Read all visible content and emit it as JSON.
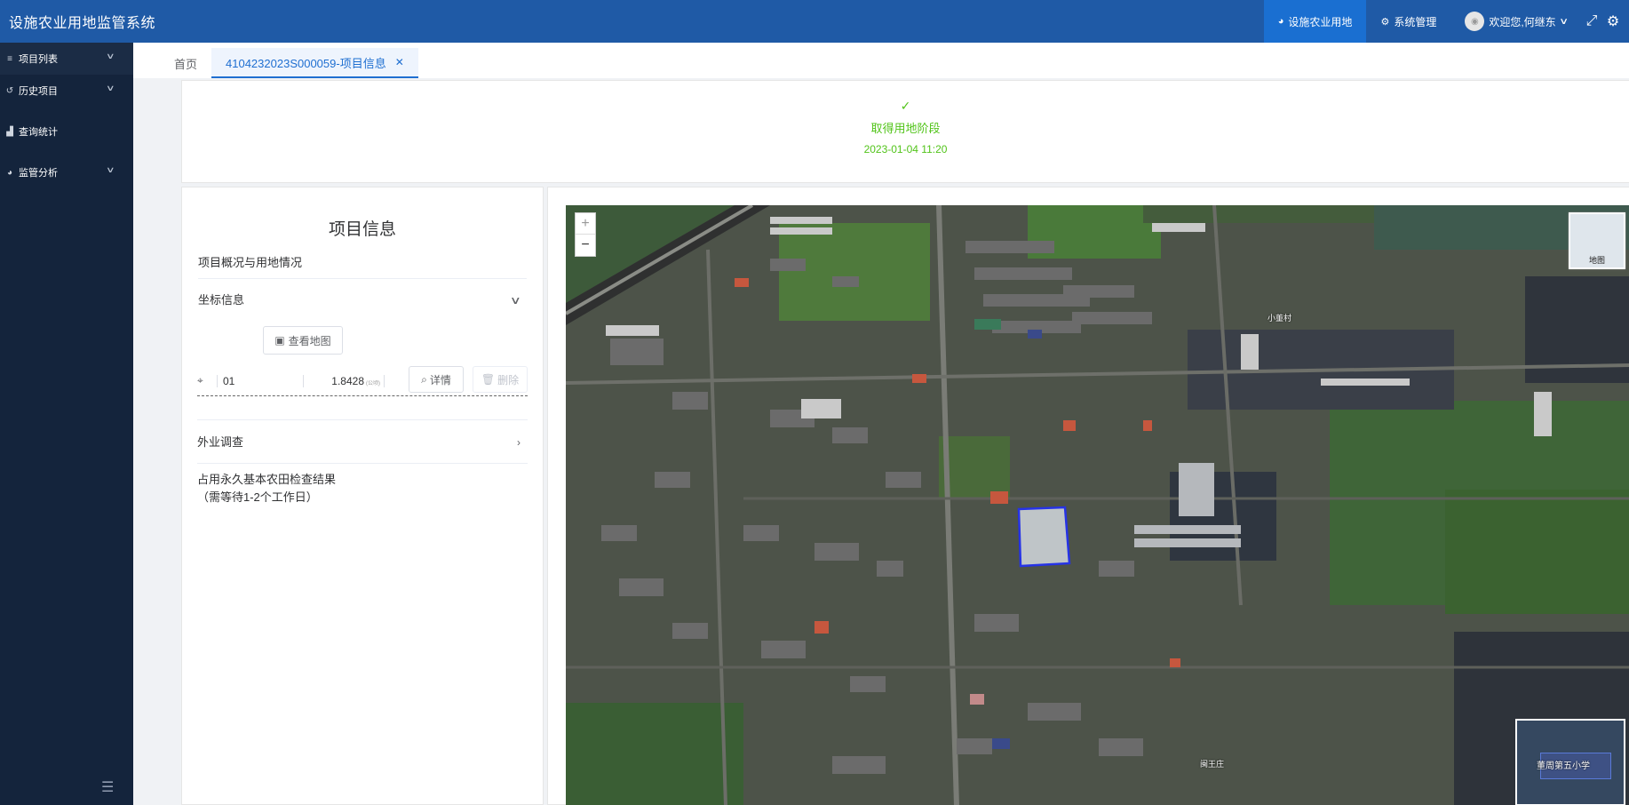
{
  "header": {
    "app_title": "设施农业用地监管系统",
    "nav": [
      {
        "label": "设施农业用地",
        "icon": "pie-chart-icon"
      },
      {
        "label": "系统管理",
        "icon": "gears-icon"
      }
    ],
    "user_greeting": "欢迎您,何继东",
    "colors": {
      "header_bg": "#1f5aa6",
      "active_nav_bg": "#1a6fd1"
    }
  },
  "sidebar": {
    "items": [
      {
        "label": "项目列表",
        "icon": "list-icon",
        "has_children": true
      },
      {
        "label": "历史项目",
        "icon": "history-icon",
        "has_children": true
      },
      {
        "label": "查询统计",
        "icon": "bar-chart-icon",
        "has_children": false
      },
      {
        "label": "监管分析",
        "icon": "pie-chart-icon",
        "has_children": true
      }
    ],
    "colors": {
      "bg": "#14243c"
    }
  },
  "tabs": [
    {
      "label": "首页",
      "active": false
    },
    {
      "label": "4104232023S000059-项目信息",
      "active": true
    }
  ],
  "stage": {
    "label": "取得用地阶段",
    "time": "2023-01-04 11:20",
    "color": "#52c41a"
  },
  "info": {
    "title": "项目信息",
    "overview_label": "项目概况与用地情况",
    "coord_label": "坐标信息",
    "view_map_label": "查看地图",
    "coord_row": {
      "id": "01",
      "area": "1.8428",
      "unit": "(公顷)",
      "detail_label": "详情",
      "delete_label": "删除"
    },
    "field_survey_label": "外业调查",
    "farmland_line1": "占用永久基本农田检查结果",
    "farmland_line2": "（需等待1-2个工作日）"
  },
  "map": {
    "zoom_in": "+",
    "zoom_out": "−",
    "layer_switch_label": "地图",
    "labels": [
      "小董村",
      "闽王庄"
    ],
    "overview_label": "董周第五小学"
  }
}
